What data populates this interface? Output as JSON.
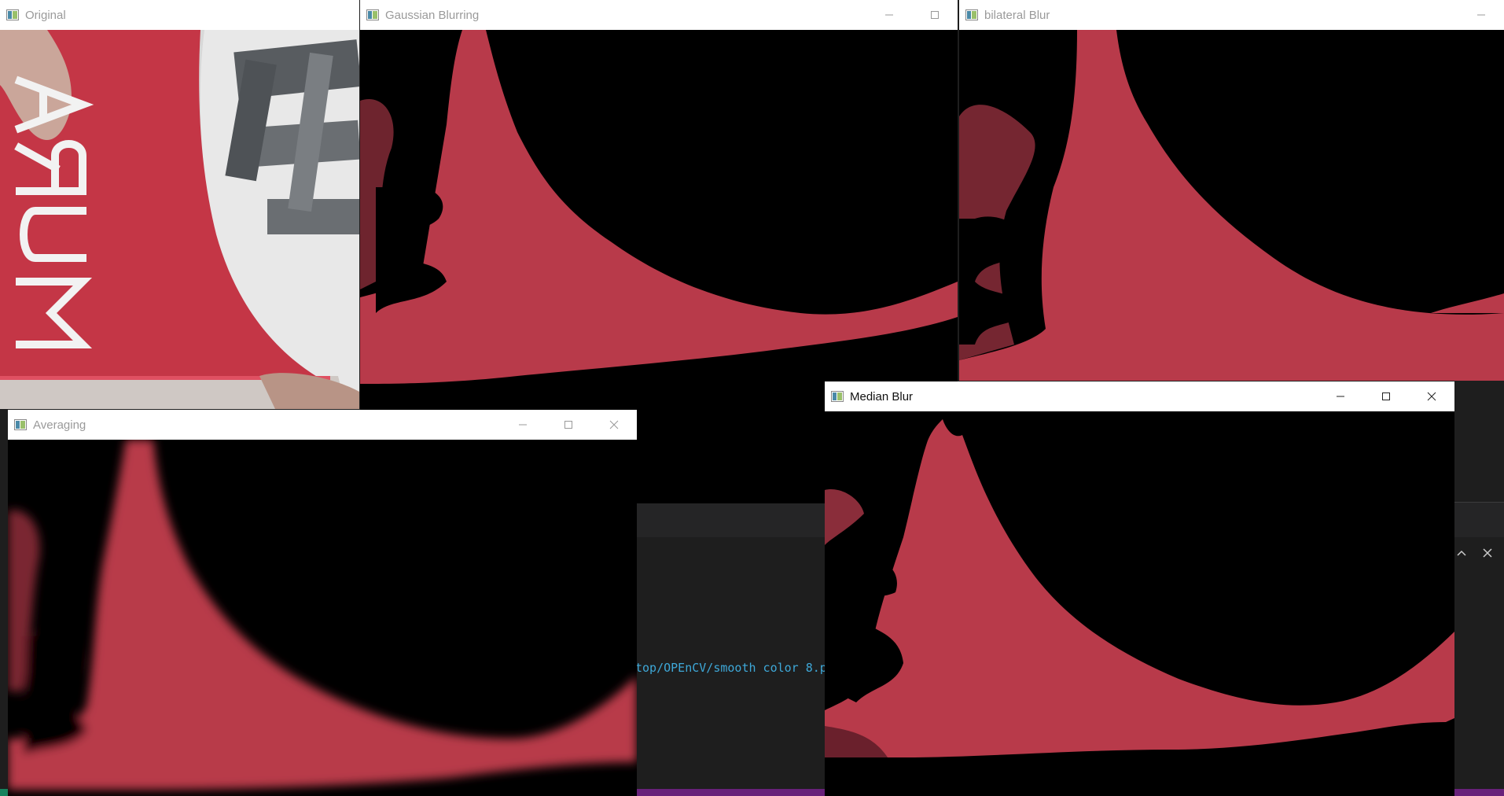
{
  "background_app": {
    "terminal_text": "top/OPEnCV/smooth color 8.p",
    "panel_icons": [
      "chevron-up-icon",
      "close-icon"
    ]
  },
  "windows": {
    "original": {
      "title": "Original",
      "active": false
    },
    "gaussian": {
      "title": "Gaussian Blurring",
      "active": false
    },
    "bilateral": {
      "title": "bilateral Blur",
      "active": false
    },
    "averaging": {
      "title": "Averaging",
      "active": false
    },
    "median": {
      "title": "Median Blur",
      "active": true
    }
  },
  "colors": {
    "mask_red": "#b83a4a",
    "background": "#000000",
    "titlebar": "#ffffff",
    "vscode_status": "#68217a"
  }
}
